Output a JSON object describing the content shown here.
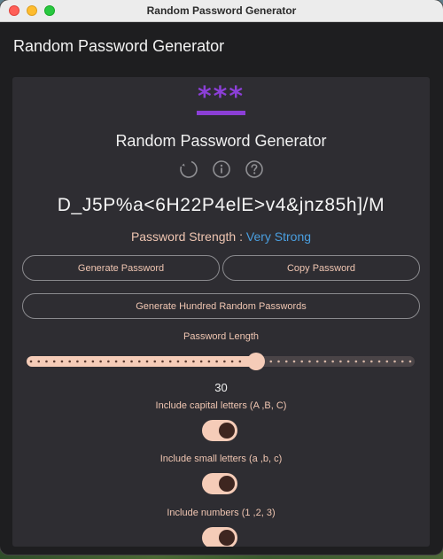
{
  "window": {
    "title": "Random Password Generator"
  },
  "appbar": {
    "title": "Random Password Generator"
  },
  "card": {
    "logo_text": "***",
    "title": "Random Password Generator",
    "icons": [
      "refresh-icon",
      "info-icon",
      "help-icon"
    ],
    "password": "D_J5P%a<6H22P4elE>v4&jnz85h]/M",
    "strength_label": "Password Strength : ",
    "strength_value": "Very Strong",
    "buttons": {
      "generate": "Generate Password",
      "copy": "Copy Password",
      "hundred": "Generate Hundred Random Passwords"
    },
    "length_label": "Password Length",
    "length_value": "30",
    "length": {
      "value": 30,
      "min": 1,
      "max": 50
    },
    "options": [
      {
        "label": "Include capital letters (A ,B, C)",
        "enabled": true
      },
      {
        "label": "Include small letters (a ,b, c)",
        "enabled": true
      },
      {
        "label": "Include numbers (1 ,2, 3)",
        "enabled": true
      }
    ]
  },
  "colors": {
    "accent_purple": "#8b3fd6",
    "peach": "#f5ccb8",
    "strength_blue": "#4a9fe0",
    "card_bg": "#2e2d32",
    "window_bg": "#1e1e20"
  }
}
